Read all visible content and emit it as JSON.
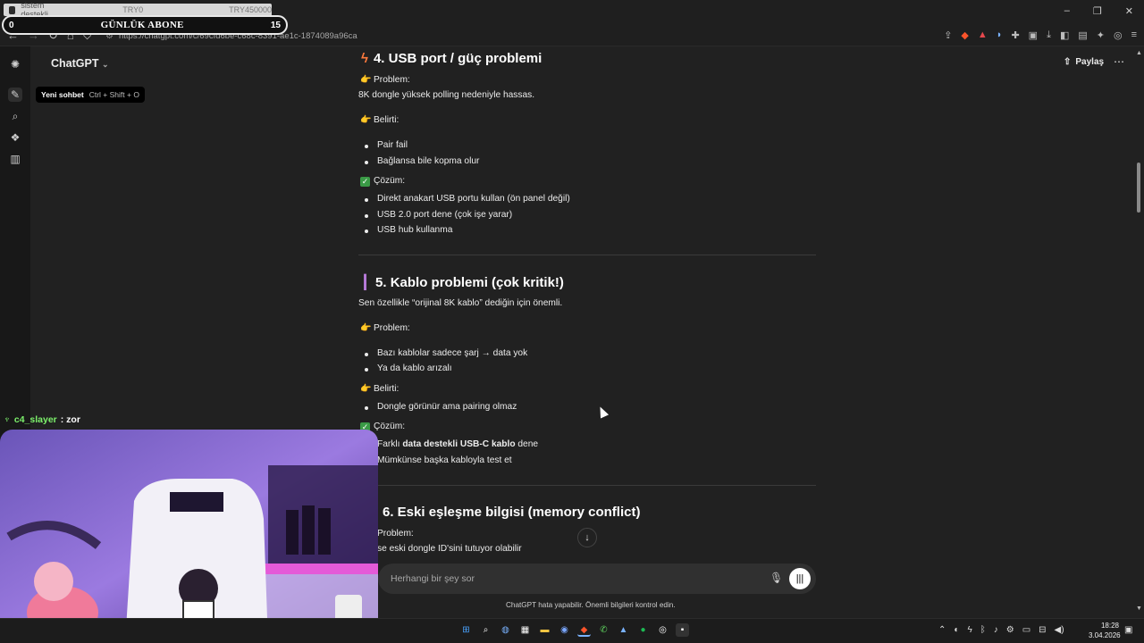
{
  "overlay_top": {
    "tab_label": "sistem destekli",
    "tab_label_2": "TRY0",
    "tab_label_3": "TRY450000",
    "subs_label": "GÜNLÜK ABONE",
    "subs_left": "0",
    "subs_right": "15"
  },
  "browser": {
    "url": "https://chatgpt.com/c/69cfd6be-c68c-8391-ae1c-1874089a96ca",
    "window_controls": [
      "–",
      "❐",
      "✕"
    ]
  },
  "chatgpt": {
    "model_name": "ChatGPT",
    "tooltip_label": "Yeni sohbet",
    "tooltip_shortcut": "Ctrl + Shift + O",
    "share_label": "Paylaş",
    "composer_placeholder": "Herhangi bir şey sor",
    "disclaimer": "ChatGPT hata yapabilir. Önemli bilgileri kontrol edin."
  },
  "answer": {
    "s4": {
      "heading": "4. USB port / güç problemi",
      "problem_label": "Problem:",
      "problem_text": "8K dongle yüksek polling nedeniyle hassas.",
      "symptom_label": "Belirti:",
      "symptoms": [
        "Pair fail",
        "Bağlansa bile kopma olur"
      ],
      "solution_label": "Çözüm:",
      "solutions": [
        "Direkt anakart USB portu kullan (ön panel değil)",
        "USB 2.0 port dene (çok işe yarar)",
        "USB hub kullanma"
      ]
    },
    "s5": {
      "heading": "5. Kablo problemi (çok kritik!)",
      "intro": "Sen özellikle “orijinal 8K kablo” dediğin için önemli.",
      "problem_label": "Problem:",
      "problems": [
        "Bazı kablolar sadece şarj → data yok",
        "Ya da kablo arızalı"
      ],
      "symptom_label": "Belirti:",
      "symptoms": [
        "Dongle görünür ama pairing olmaz"
      ],
      "solution_label": "Çözüm:",
      "solution_1_pre": "Farklı ",
      "solution_1_bold": "data destekli USB-C kablo",
      "solution_1_post": " dene",
      "solution_2": "Mümkünse başka kabloyla test et"
    },
    "s6": {
      "heading": "6. Eski eşleşme bilgisi (memory conflict)",
      "problem_label": "Problem:",
      "problem_text": "se eski dongle ID'sini tutuyor olabilir"
    }
  },
  "stream_chat": {
    "user": "c4_slayer",
    "message": ": zor"
  },
  "taskbar": {
    "time": "18:28",
    "date": "3.04.2026"
  },
  "colors": {
    "background": "#212121",
    "rail": "#181818",
    "composer": "#303030",
    "chat_user": "#7cf06b",
    "check": "#3a9b46"
  }
}
